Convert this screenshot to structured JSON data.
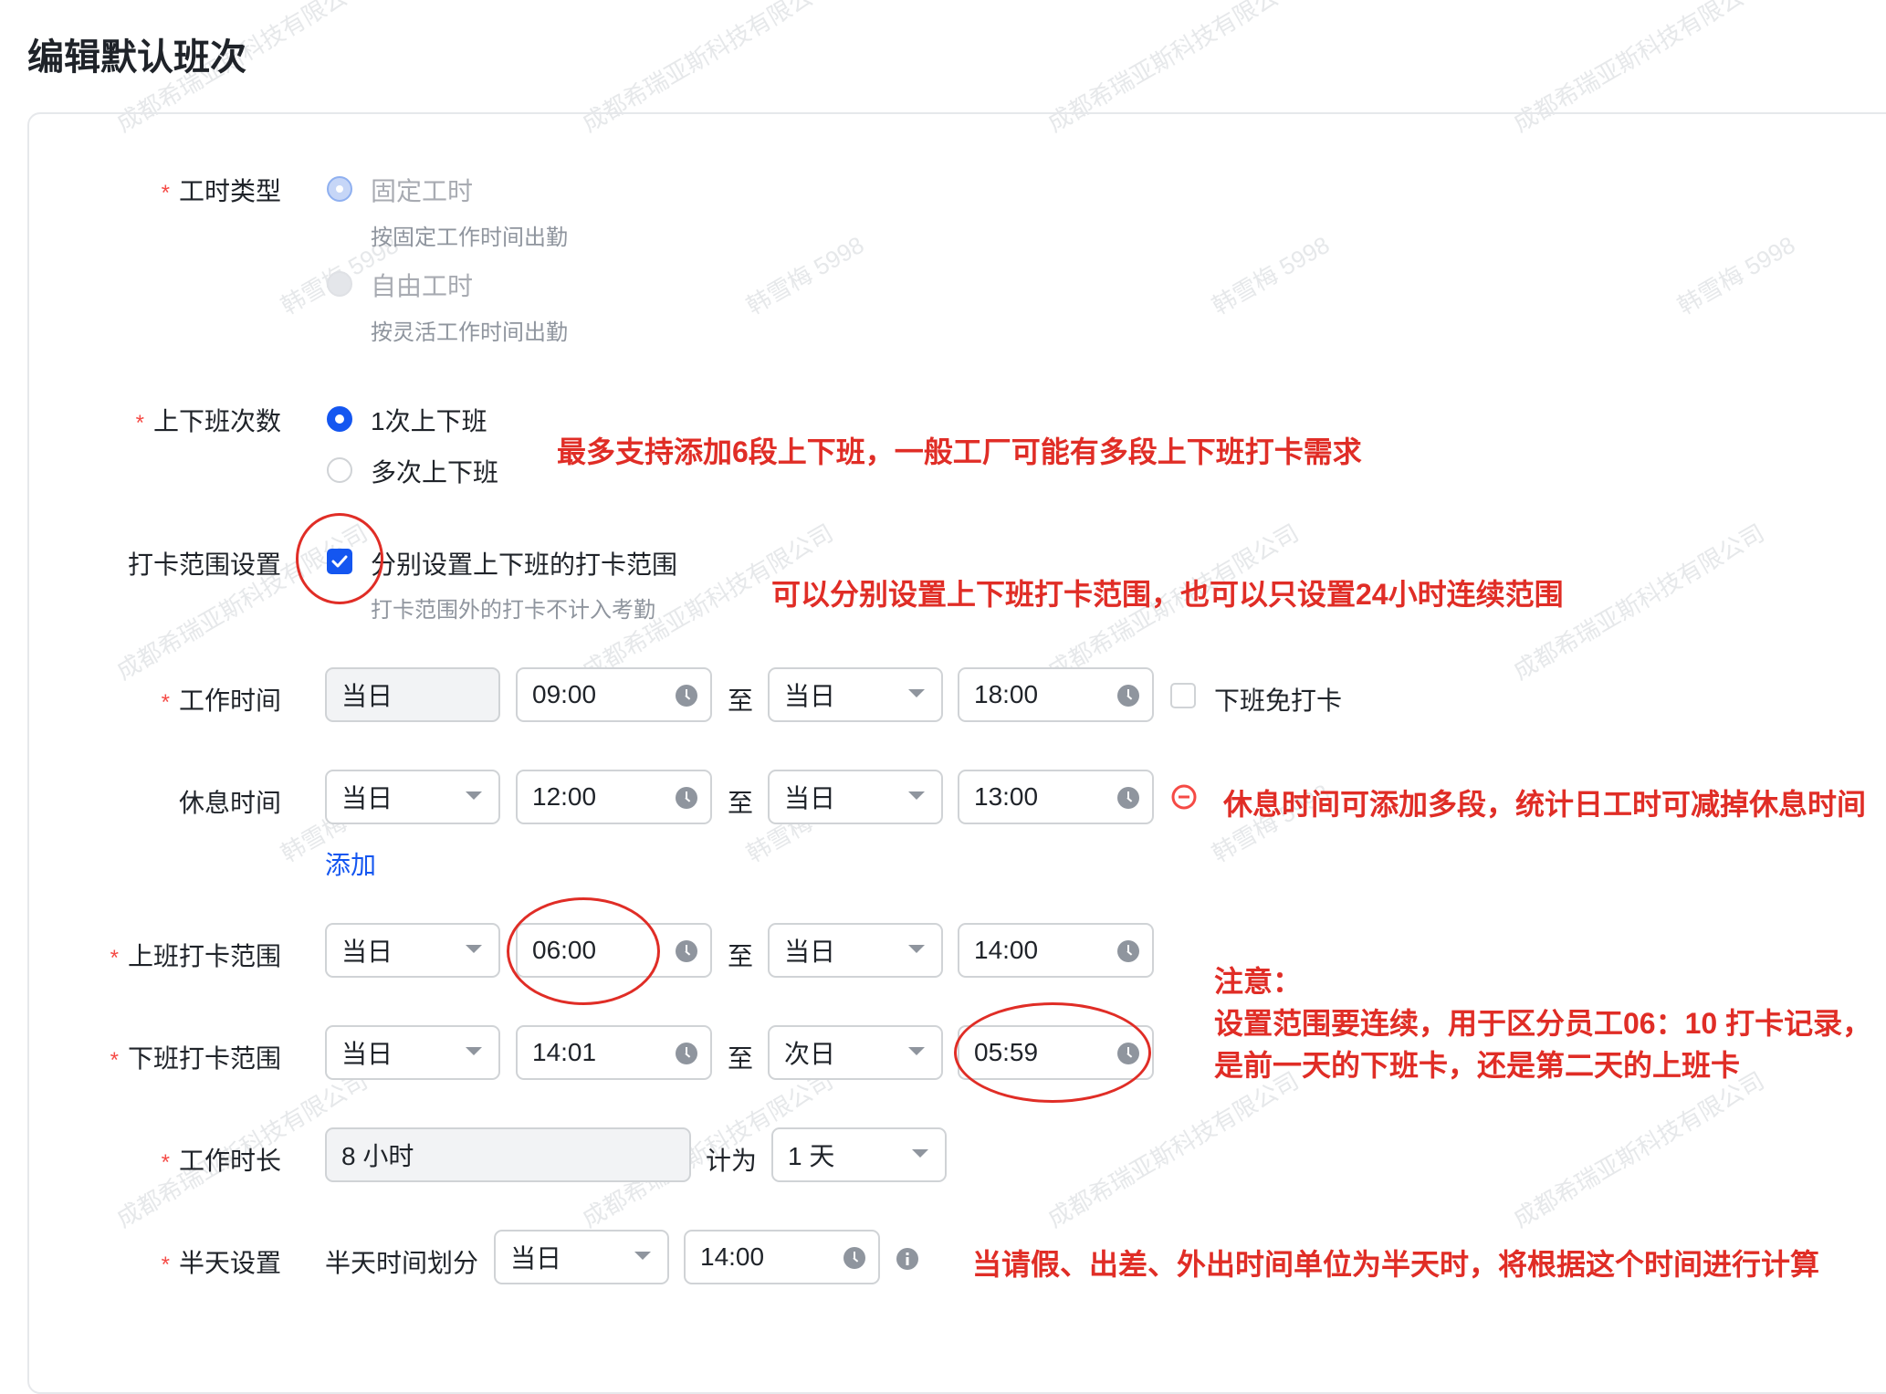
{
  "page": {
    "title": "编辑默认班次"
  },
  "work_type": {
    "label": "工时类型",
    "options": [
      {
        "label": "固定工时",
        "hint": "按固定工作时间出勤"
      },
      {
        "label": "自由工时",
        "hint": "按灵活工作时间出勤"
      }
    ]
  },
  "shift_count": {
    "label": "上下班次数",
    "options": [
      {
        "label": "1次上下班"
      },
      {
        "label": "多次上下班"
      }
    ]
  },
  "punch_range": {
    "label": "打卡范围设置",
    "checkbox_label": "分别设置上下班的打卡范围",
    "hint": "打卡范围外的打卡不计入考勤"
  },
  "work_time": {
    "label": "工作时间",
    "start_day": "当日",
    "start_time": "09:00",
    "to": "至",
    "end_day": "当日",
    "end_time": "18:00",
    "no_punch_label": "下班免打卡"
  },
  "rest_time": {
    "label": "休息时间",
    "start_day": "当日",
    "start_time": "12:00",
    "to": "至",
    "end_day": "当日",
    "end_time": "13:00",
    "add_label": "添加"
  },
  "on_duty_range": {
    "label": "上班打卡范围",
    "start_day": "当日",
    "start_time": "06:00",
    "to": "至",
    "end_day": "当日",
    "end_time": "14:00"
  },
  "off_duty_range": {
    "label": "下班打卡范围",
    "start_day": "当日",
    "start_time": "14:01",
    "to": "至",
    "end_day": "次日",
    "end_time": "05:59"
  },
  "work_duration": {
    "label": "工作时长",
    "value": "8 小时",
    "count_as_label": "计为",
    "count_as_value": "1 天"
  },
  "half_day": {
    "label": "半天设置",
    "split_label": "半天时间划分",
    "day": "当日",
    "time": "14:00"
  },
  "annotations": {
    "a1": "最多支持添加6段上下班，一般工厂可能有多段上下班打卡需求",
    "a2": "可以分别设置上下班打卡范围，也可以只设置24小时连续范围",
    "a3": "休息时间可添加多段，统计日工时可减掉休息时间",
    "a4_line1": "注意：",
    "a4_line2": "设置范围要连续，用于区分员工06：10 打卡记录，",
    "a4_line3": "是前一天的下班卡，还是第二天的上班卡",
    "a5": "当请假、出差、外出时间单位为半天时，将根据这个时间进行计算"
  },
  "watermark": {
    "company": "成都希瑞亚斯科技有限公司",
    "user": "韩雪梅 5998"
  },
  "colors": {
    "primary": "#1456f0",
    "annotation": "#e02d26",
    "required": "#f54a45"
  },
  "required_mark": "*"
}
